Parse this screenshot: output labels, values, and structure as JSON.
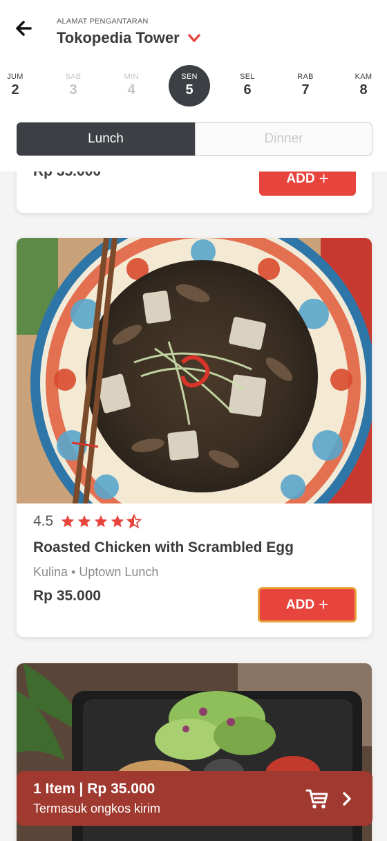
{
  "header": {
    "address_label": "ALAMAT PENGANTARAN",
    "address_value": "Tokopedia Tower"
  },
  "days": [
    {
      "name": "JUM",
      "date": "2",
      "state": "normal"
    },
    {
      "name": "SAB",
      "date": "3",
      "state": "disabled"
    },
    {
      "name": "MIN",
      "date": "4",
      "state": "disabled"
    },
    {
      "name": "SEN",
      "date": "5",
      "state": "active"
    },
    {
      "name": "SEL",
      "date": "6",
      "state": "normal"
    },
    {
      "name": "RAB",
      "date": "7",
      "state": "normal"
    },
    {
      "name": "KAM",
      "date": "8",
      "state": "normal"
    }
  ],
  "meal_tabs": {
    "lunch": "Lunch",
    "dinner": "Dinner",
    "selected": "Lunch"
  },
  "cards": [
    {
      "price": "Rp 35.000",
      "add_label": "ADD",
      "add_plus": "+"
    },
    {
      "rating": "4.5",
      "stars": 4.5,
      "name": "Roasted Chicken with Scrambled Egg",
      "vendor": "Kulina • Uptown Lunch",
      "price": "Rp 35.000",
      "add_label": "ADD",
      "add_plus": "+"
    }
  ],
  "cart": {
    "title": "1 Item | Rp 35.000",
    "subtitle": "Termasuk ongkos kirim"
  },
  "colors": {
    "accent": "#e8443e",
    "dark": "#3c4045",
    "cart_bar": "#a0392f"
  },
  "icons": {
    "back": "arrow-left-icon",
    "dropdown": "chevron-down-icon",
    "star": "star-icon",
    "cart": "shopping-cart-icon",
    "next": "chevron-right-icon"
  }
}
